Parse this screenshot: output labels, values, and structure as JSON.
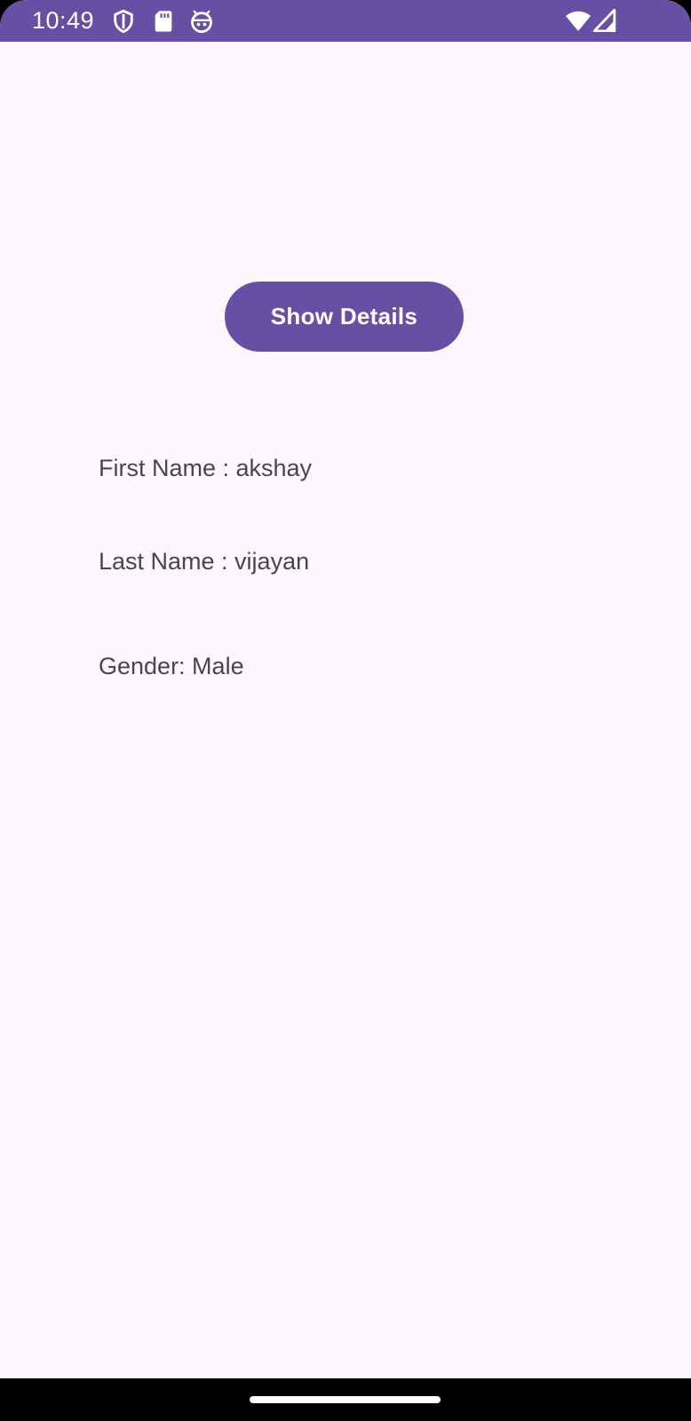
{
  "status_bar": {
    "time": "10:49",
    "background": "#6750a4",
    "left_icons": [
      "shield-icon",
      "sd-card-icon",
      "android-icon"
    ],
    "right_icons": [
      "wifi-icon",
      "cellular-signal-icon"
    ]
  },
  "main": {
    "show_details_button": "Show Details",
    "first_name": "First Name : akshay",
    "last_name": "Last Name : vijayan",
    "gender": "Gender: Male"
  },
  "colors": {
    "accent": "#6750a4",
    "background": "#fdf8fd",
    "text": "#49454f"
  }
}
